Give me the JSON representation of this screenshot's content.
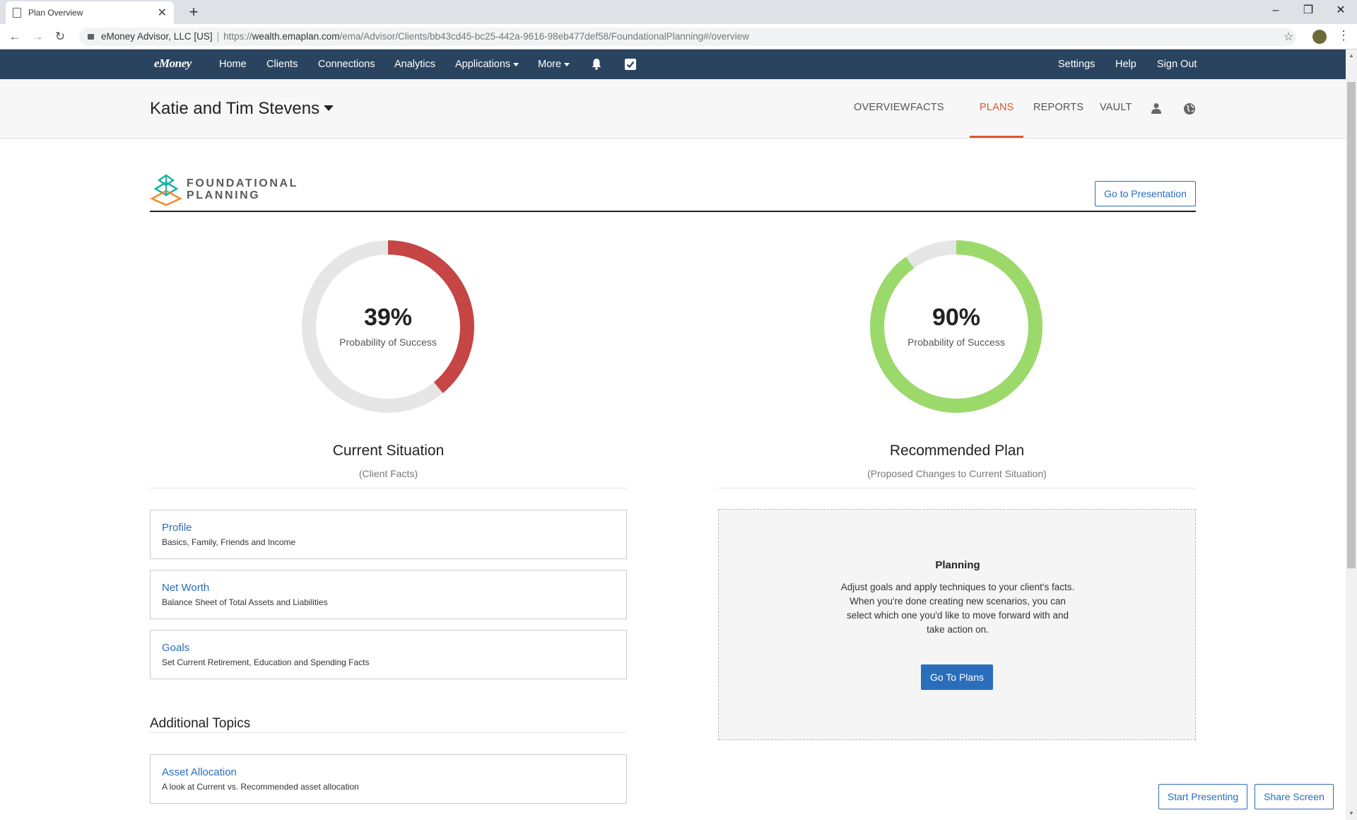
{
  "browser": {
    "tab_title": "Plan Overview",
    "new_tab_symbol": "+",
    "site_identity": "eMoney Advisor, LLC [US]",
    "url_prefix": "https://",
    "url_host": "wealth.emaplan.com",
    "url_path": "/ema/Advisor/Clients/bb43cd45-bc25-442a-9616-98eb477def58/FoundationalPlanning#/overview"
  },
  "appnav": {
    "logo": "eMoney",
    "items": [
      "Home",
      "Clients",
      "Connections",
      "Analytics",
      "Applications",
      "More"
    ],
    "right_items": [
      "Settings",
      "Help",
      "Sign Out"
    ]
  },
  "client": {
    "name": "Katie and Tim Stevens",
    "tabs": [
      "OVERVIEW",
      "FACTS",
      "PLANS",
      "REPORTS",
      "VAULT"
    ],
    "active_tab": "PLANS",
    "accent_color": "#d9582b"
  },
  "header": {
    "brand_line1": "FOUNDATIONAL",
    "brand_line2": "PLANNING",
    "go_to_presentation": "Go to Presentation"
  },
  "current": {
    "percent_label": "39%",
    "percent_value": 39,
    "caption": "Probability of Success",
    "title": "Current Situation",
    "subtitle": "(Client Facts)",
    "color": "#c64545"
  },
  "recommended": {
    "percent_label": "90%",
    "percent_value": 90,
    "caption": "Probability of Success",
    "title": "Recommended Plan",
    "subtitle": "(Proposed Changes to Current Situation)",
    "color": "#9cd96b"
  },
  "cards": [
    {
      "title": "Profile",
      "desc": "Basics, Family, Friends and Income"
    },
    {
      "title": "Net Worth",
      "desc": "Balance Sheet of Total Assets and Liabilities"
    },
    {
      "title": "Goals",
      "desc": "Set Current Retirement, Education and Spending Facts"
    }
  ],
  "additional": {
    "heading": "Additional Topics",
    "card": {
      "title": "Asset Allocation",
      "desc": "A look at Current vs. Recommended asset allocation"
    }
  },
  "planning": {
    "title": "Planning",
    "description": "Adjust goals and apply techniques to your client's facts. When you're done creating new scenarios, you can select which one you'd like to move forward with and take action on.",
    "button": "Go To Plans"
  },
  "footer": {
    "start_presenting": "Start Presenting",
    "share_screen": "Share Screen"
  }
}
